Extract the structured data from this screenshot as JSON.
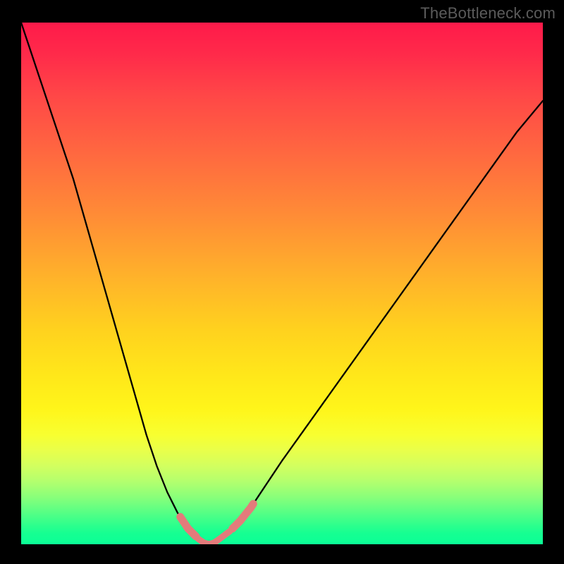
{
  "watermark": "TheBottleneck.com",
  "colors": {
    "background": "#000000",
    "gradient_top": "#ff1a4a",
    "gradient_mid": "#ffe81a",
    "gradient_bottom": "#0bff96",
    "curve": "#000000",
    "highlight": "#e47b7b"
  },
  "chart_data": {
    "type": "line",
    "title": "",
    "xlabel": "",
    "ylabel": "",
    "xlim": [
      0,
      100
    ],
    "ylim": [
      0,
      100
    ],
    "x": [
      0,
      2,
      4,
      6,
      8,
      10,
      12,
      14,
      16,
      18,
      20,
      22,
      24,
      26,
      28,
      30,
      32,
      34,
      35,
      36,
      37,
      38,
      40,
      42,
      44,
      46,
      48,
      50,
      55,
      60,
      65,
      70,
      75,
      80,
      85,
      90,
      95,
      100
    ],
    "values": [
      100,
      94,
      88,
      82,
      76,
      70,
      63,
      56,
      49,
      42,
      35,
      28,
      21,
      15,
      10,
      6,
      3,
      1,
      0.3,
      0,
      0.3,
      1,
      2.5,
      4.5,
      7,
      10,
      13,
      16,
      23,
      30,
      37,
      44,
      51,
      58,
      65,
      72,
      79,
      85
    ],
    "highlight_segments": {
      "left_branch_x": [
        30.5,
        33.5
      ],
      "right_branch_x": [
        40.5,
        44.5
      ],
      "bottom_x": [
        33.0,
        40.0
      ]
    },
    "notes": "Axes are unlabeled; curve shows a V-shaped bottleneck with minimum near x≈36. Values are read approximately as percentage of plot height from bottom. Background gradient encodes severity (red=high, green=low)."
  }
}
